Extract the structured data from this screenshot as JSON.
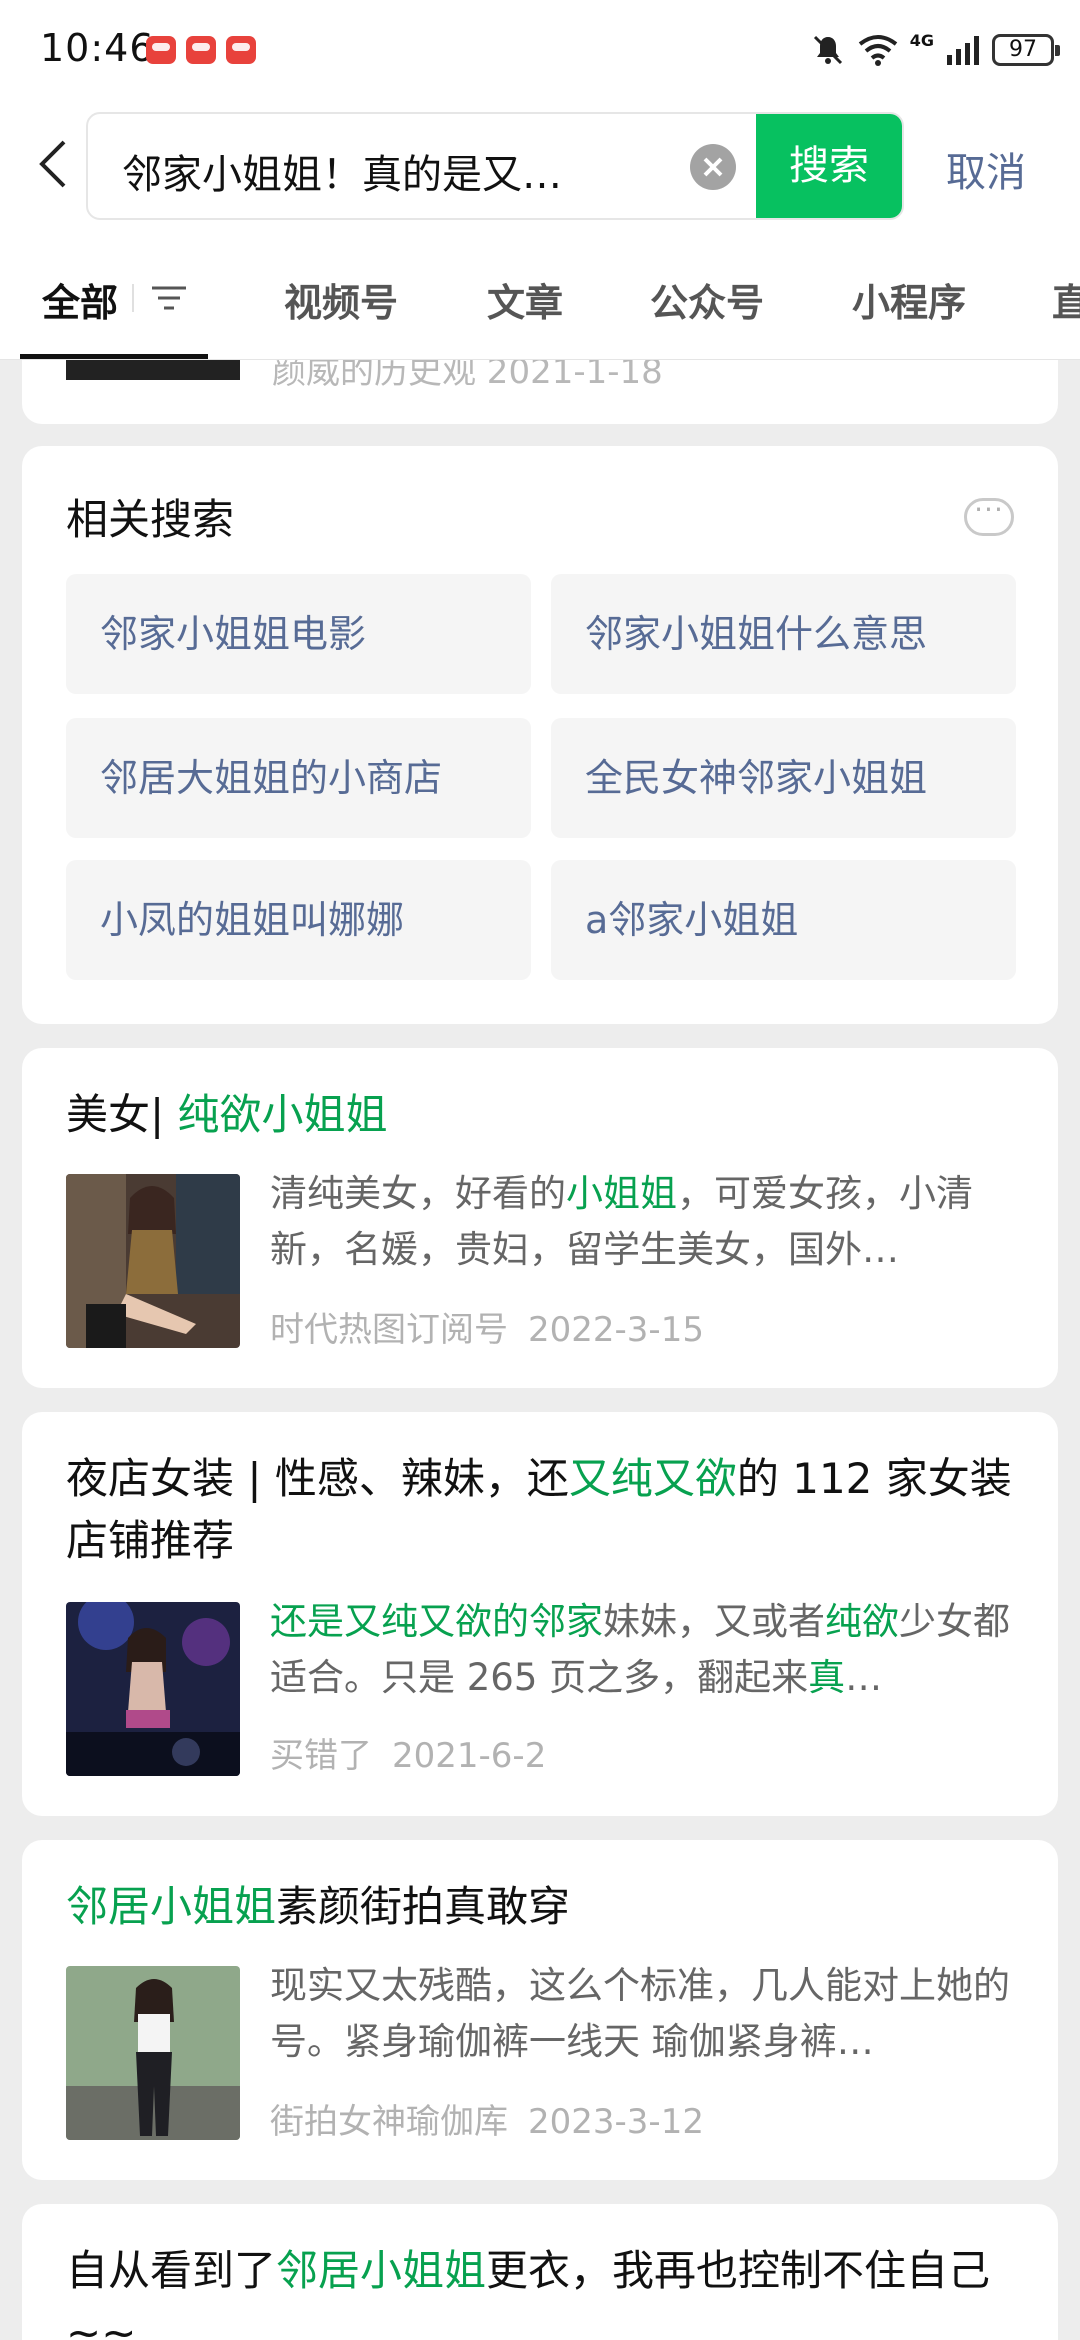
{
  "status_bar": {
    "time": "10:46",
    "network": "4G",
    "battery": "97"
  },
  "search": {
    "query": "邻家小姐姐！真的是又…",
    "button_label": "搜索",
    "cancel_label": "取消"
  },
  "tabs": [
    {
      "label": "全部",
      "active": true
    },
    {
      "label": "视频号"
    },
    {
      "label": "文章"
    },
    {
      "label": "公众号"
    },
    {
      "label": "小程序"
    },
    {
      "label": "直"
    }
  ],
  "previous_card": {
    "meta": "颜威的历史观  2021-1-18"
  },
  "related": {
    "title": "相关搜索",
    "items": [
      "邻家小姐姐电影",
      "邻家小姐姐什么意思",
      "邻居大姐姐的小商店",
      "全民女神邻家小姐姐",
      "小凤的姐姐叫娜娜",
      "a邻家小姐姐"
    ]
  },
  "articles": [
    {
      "title_plain": "美女| ",
      "title_hl": "纯欲小姐姐",
      "summary_parts": [
        {
          "t": "清纯美女，好看的"
        },
        {
          "t": "小姐姐",
          "hl": true
        },
        {
          "t": "，可爱女孩，小清新，名媛，贵妇，留学生美女，国外…"
        }
      ],
      "source": "时代热图订阅号",
      "date": "2022-3-15"
    },
    {
      "title_parts": [
        {
          "t": "夜店女装 | 性感、辣妹，还"
        },
        {
          "t": "又纯又欲",
          "hl": true
        },
        {
          "t": "的 112 家女装店铺推荐"
        }
      ],
      "summary_parts": [
        {
          "t": "还是又纯又欲的邻家",
          "hl": true
        },
        {
          "t": "妹妹，又或者"
        },
        {
          "t": "纯欲",
          "hl": true
        },
        {
          "t": "少女都适合。只是 265 页之多，翻起来"
        },
        {
          "t": "真",
          "hl": true
        },
        {
          "t": "…"
        }
      ],
      "source": "买错了",
      "date": "2021-6-2"
    },
    {
      "title_parts": [
        {
          "t": "邻居小姐姐",
          "hl": true
        },
        {
          "t": "素颜街拍真敢穿"
        }
      ],
      "summary_parts": [
        {
          "t": "现实又太残酷，这么个标准，几人能对上她的号。紧身瑜伽裤一线天 瑜伽紧身裤…"
        }
      ],
      "source": "街拍女神瑜伽库",
      "date": "2023-3-12"
    },
    {
      "title_parts": [
        {
          "t": "自从看到了"
        },
        {
          "t": "邻居小姐姐",
          "hl": true
        },
        {
          "t": "更衣，我再也控制不住自己~~"
        }
      ]
    }
  ]
}
